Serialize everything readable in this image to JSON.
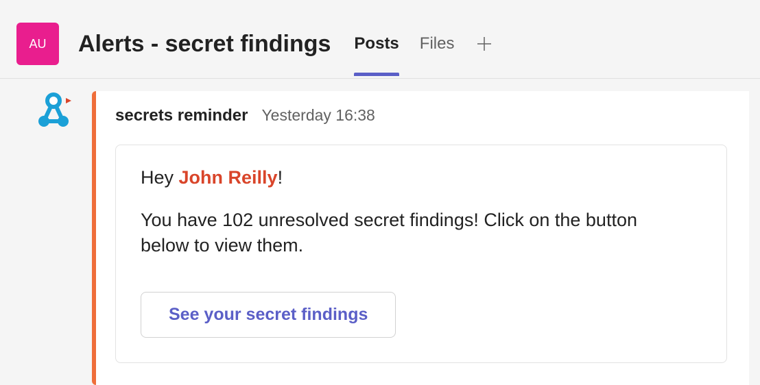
{
  "header": {
    "avatar_initials": "AU",
    "channel_title": "Alerts - secret findings",
    "tabs": {
      "posts": "Posts",
      "files": "Files"
    }
  },
  "message": {
    "sender": "secrets reminder",
    "timestamp": "Yesterday 16:38",
    "greeting_prefix": "Hey ",
    "mention_name": "John Reilly",
    "greeting_suffix": "!",
    "body": "You have 102 unresolved secret findings! Click on the button below to view them.",
    "cta_label": "See your secret findings"
  }
}
